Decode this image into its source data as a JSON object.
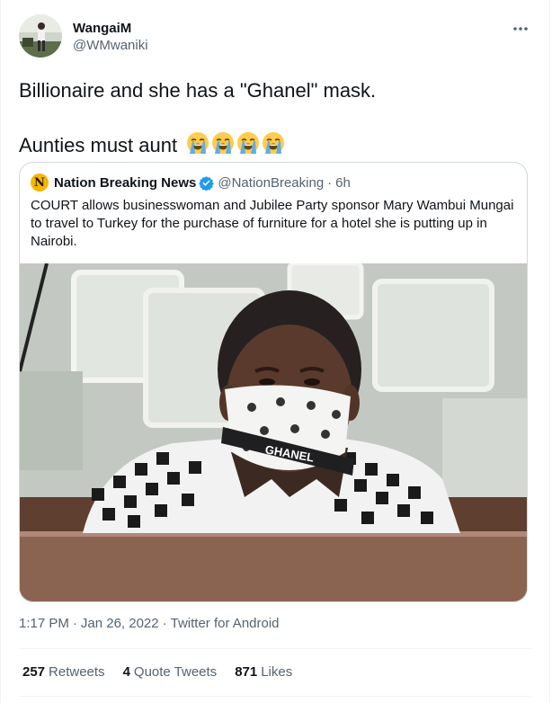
{
  "author": {
    "display_name": "WangaiM",
    "handle": "@WMwaniki"
  },
  "more_icon": "more-horizontal-icon",
  "tweet": {
    "line1": "Billionaire and she has a \"Ghanel\" mask.",
    "line2": "Aunties must aunt",
    "emoji": [
      "loudly-crying-face",
      "loudly-crying-face",
      "loudly-crying-face",
      "loudly-crying-face"
    ]
  },
  "quoted": {
    "logo_letter": "N",
    "name": "Nation Breaking News",
    "handle": "@NationBreaking",
    "dot": "·",
    "time": "6h",
    "text": "COURT allows businesswoman and Jubilee Party sponsor Mary Wambui Mungai to travel to Turkey for the purchase of furniture for a hotel she is putting up in Nairobi.",
    "mask_text": "GHANEL"
  },
  "meta": {
    "time": "1:17 PM",
    "date": "Jan 26, 2022",
    "source": "Twitter for Android",
    "sep": "·"
  },
  "stats": {
    "retweets_count": "257",
    "retweets_label": "Retweets",
    "quotes_count": "4",
    "quotes_label": "Quote Tweets",
    "likes_count": "871",
    "likes_label": "Likes"
  },
  "colors": {
    "text": "#0f1419",
    "secondary": "#536471",
    "border": "#cfd9de",
    "verified": "#1d9bf0"
  }
}
